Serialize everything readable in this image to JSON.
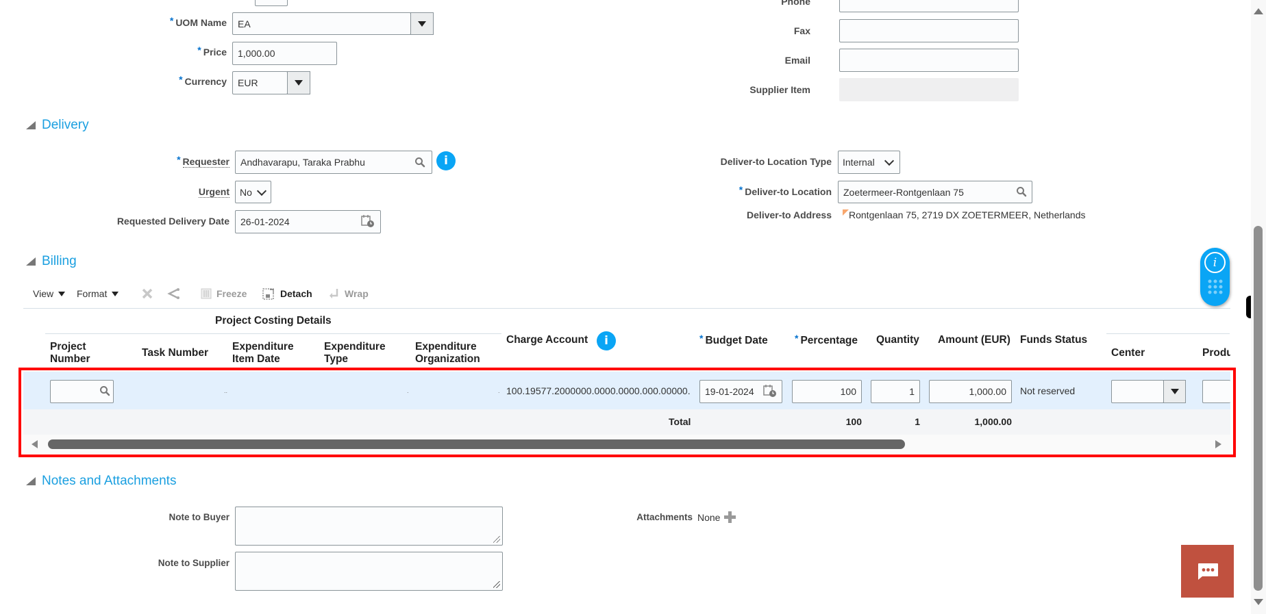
{
  "item_form": {
    "uom_name": {
      "label": "UOM Name",
      "required": true,
      "value": "EA"
    },
    "price": {
      "label": "Price",
      "required": true,
      "value": "1,000.00"
    },
    "currency": {
      "label": "Currency",
      "required": true,
      "value": "EUR"
    },
    "phone": {
      "label": "Phone",
      "value": ""
    },
    "fax": {
      "label": "Fax",
      "value": ""
    },
    "email": {
      "label": "Email",
      "value": ""
    },
    "supplier_item": {
      "label": "Supplier Item",
      "value": ""
    }
  },
  "delivery": {
    "title": "Delivery",
    "requester": {
      "label": "Requester",
      "required": true,
      "value": "Andhavarapu, Taraka Prabhu",
      "info_glyph": "i"
    },
    "urgent": {
      "label": "Urgent",
      "value": "No"
    },
    "requested_delivery_date": {
      "label": "Requested Delivery Date",
      "value": "26-01-2024"
    },
    "deliver_to_location_type": {
      "label": "Deliver-to Location Type",
      "value": "Internal"
    },
    "deliver_to_location": {
      "label": "Deliver-to Location",
      "required": true,
      "value": "Zoetermeer-Rontgenlaan 75"
    },
    "deliver_to_address": {
      "label": "Deliver-to Address",
      "value": "Rontgenlaan 75, 2719 DX ZOETERMEER, Netherlands"
    }
  },
  "billing": {
    "title": "Billing",
    "toolbar": {
      "view": "View",
      "format": "Format",
      "freeze": "Freeze",
      "detach": "Detach",
      "wrap": "Wrap"
    },
    "group_header": "Project Costing Details",
    "columns": {
      "project_number": [
        "Project",
        "Number"
      ],
      "task_number": "Task Number",
      "expenditure_item_date": [
        "Expenditure",
        "Item Date"
      ],
      "expenditure_type": [
        "Expenditure",
        "Type"
      ],
      "expenditure_organization": [
        "Expenditure",
        "Organization"
      ],
      "charge_account": "Charge Account",
      "charge_account_info": "i",
      "budget_date": "Budget Date",
      "percentage": "Percentage",
      "quantity": "Quantity",
      "amount": "Amount (EUR)",
      "funds_status": "Funds Status",
      "center": "Center",
      "product": "Produ"
    },
    "row": {
      "project_number": "",
      "task_number_dots": "..",
      "expenditure_type_dot": ".",
      "expenditure_org_dot": ".",
      "charge_account": "100.19577.2000000.0000.0000.000.00000.",
      "budget_date": "19-01-2024",
      "percentage": "100",
      "quantity": "1",
      "amount": "1,000.00",
      "funds_status": "Not reserved",
      "center": "",
      "product": ""
    },
    "totals": {
      "label": "Total",
      "percentage": "100",
      "quantity": "1",
      "amount": "1,000.00"
    },
    "highlight_color": "#ff0000",
    "row_bg": "#e3f0fd"
  },
  "notes": {
    "title": "Notes and Attachments",
    "note_to_buyer": {
      "label": "Note to Buyer",
      "value": ""
    },
    "note_to_supplier": {
      "label": "Note to Supplier",
      "value": ""
    },
    "attachments": {
      "label": "Attachments",
      "value": "None"
    }
  },
  "widgets": {
    "help_info_glyph": "i",
    "chat_button_color": "#c0513f",
    "accent": "#0aa5f5"
  }
}
